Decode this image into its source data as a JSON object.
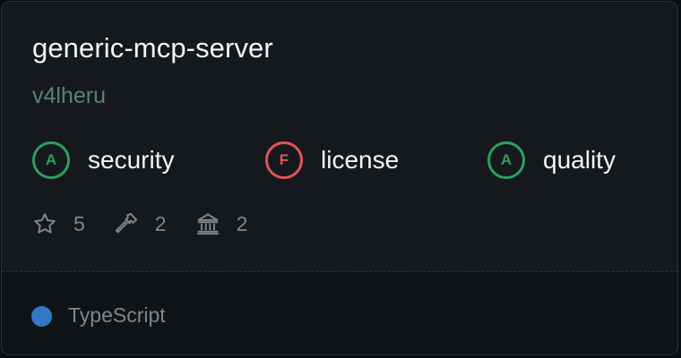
{
  "server": {
    "name": "generic-mcp-server",
    "owner": "v4lheru"
  },
  "grades": [
    {
      "grade": "A",
      "label": "security",
      "color": "#2e9e5f"
    },
    {
      "grade": "F",
      "label": "license",
      "color": "#e25555"
    },
    {
      "grade": "A",
      "label": "quality",
      "color": "#2e9e5f"
    }
  ],
  "stats": {
    "stars": "5",
    "tools": "2",
    "resources": "2"
  },
  "language": {
    "name": "TypeScript",
    "color": "#3178c6"
  },
  "icons": [
    "star-icon",
    "hammer-icon",
    "bank-icon"
  ]
}
